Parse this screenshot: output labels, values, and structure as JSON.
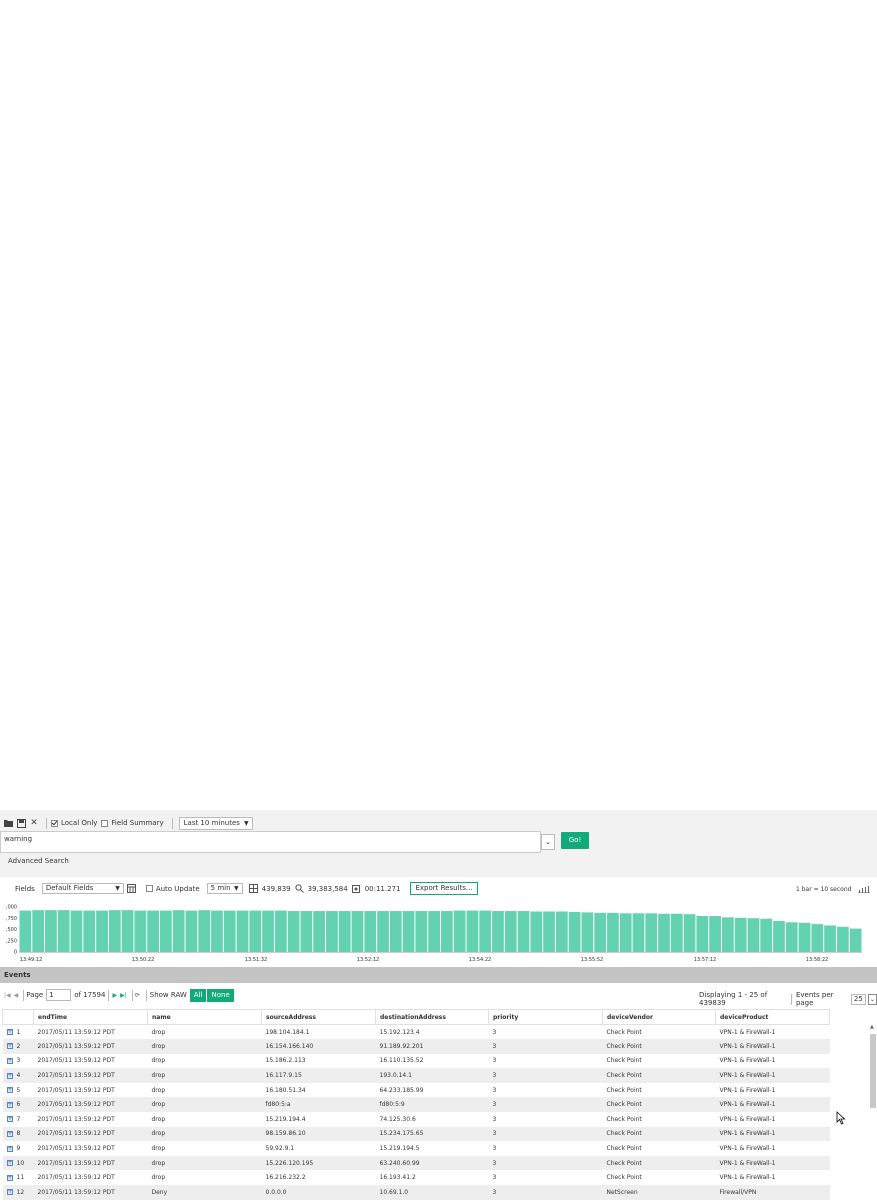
{
  "toolbar": {
    "local_only_label": "Local Only",
    "local_only_checked": true,
    "field_summary_label": "Field Summary",
    "field_summary_checked": false,
    "time_range": "Last 10 minutes"
  },
  "search": {
    "query": "warning",
    "go_label": "Go!",
    "advanced_label": "Advanced Search"
  },
  "fields_bar": {
    "fields_label": "Fields",
    "fields_value": "Default Fields",
    "auto_update_label": "Auto Update",
    "auto_update_checked": false,
    "interval": "5 min",
    "event_count": "439,839",
    "scanned_count": "39,383,584",
    "elapsed": "00:11.271",
    "export_label": "Export Results...",
    "bar_scale": "1 bar = 10 second"
  },
  "chart_data": {
    "type": "bar",
    "y_ticks": [
      "0",
      ",250",
      ",500",
      ",750",
      ",000"
    ],
    "x_ticks": [
      "13:49:12",
      "13:50:22",
      "13:51:32",
      "13:52:12",
      "13:54:22",
      "13:55:52",
      "13:57:12",
      "13:58:22"
    ],
    "values": [
      0.92,
      0.93,
      0.93,
      0.93,
      0.92,
      0.92,
      0.92,
      0.93,
      0.93,
      0.92,
      0.92,
      0.92,
      0.93,
      0.92,
      0.93,
      0.92,
      0.92,
      0.92,
      0.92,
      0.92,
      0.92,
      0.91,
      0.91,
      0.91,
      0.91,
      0.91,
      0.91,
      0.91,
      0.91,
      0.91,
      0.91,
      0.91,
      0.91,
      0.91,
      0.92,
      0.92,
      0.92,
      0.91,
      0.91,
      0.91,
      0.9,
      0.9,
      0.9,
      0.89,
      0.88,
      0.87,
      0.87,
      0.86,
      0.86,
      0.86,
      0.85,
      0.85,
      0.84,
      0.8,
      0.8,
      0.77,
      0.76,
      0.75,
      0.74,
      0.69,
      0.66,
      0.65,
      0.62,
      0.59,
      0.56,
      0.52
    ],
    "color": "#64d2b1"
  },
  "events": {
    "title": "Events",
    "page_label": "Page",
    "page_value": "1",
    "of_pages": "of 17594",
    "show_raw_label": "Show RAW",
    "all_label": "All",
    "none_label": "None",
    "displaying": "Displaying 1 - 25 of 439839",
    "epp_label": "Events per page",
    "epp_value": "25",
    "columns": [
      "endTime",
      "name",
      "sourceAddress",
      "destinationAddress",
      "priority",
      "deviceVendor",
      "deviceProduct"
    ],
    "rows": [
      [
        "1",
        "2017/05/11 13:59:12 PDT",
        "drop",
        "198.104.184.1",
        "15.192.123.4",
        "3",
        "Check Point",
        "VPN-1 & FireWall-1"
      ],
      [
        "2",
        "2017/05/11 13:59:12 PDT",
        "drop",
        "16.154.166.140",
        "91.189.92.201",
        "3",
        "Check Point",
        "VPN-1 & FireWall-1"
      ],
      [
        "3",
        "2017/05/11 13:59:12 PDT",
        "drop",
        "15.186.2.113",
        "16.110.135.52",
        "3",
        "Check Point",
        "VPN-1 & FireWall-1"
      ],
      [
        "4",
        "2017/05/11 13:59:12 PDT",
        "drop",
        "16.117.9.15",
        "193.0.14.1",
        "3",
        "Check Point",
        "VPN-1 & FireWall-1"
      ],
      [
        "5",
        "2017/05/11 13:59:12 PDT",
        "drop",
        "16.180.51.34",
        "64.233.185.99",
        "3",
        "Check Point",
        "VPN-1 & FireWall-1"
      ],
      [
        "6",
        "2017/05/11 13:59:12 PDT",
        "drop",
        "fd80:5:a",
        "fd80:5:9",
        "3",
        "Check Point",
        "VPN-1 & FireWall-1"
      ],
      [
        "7",
        "2017/05/11 13:59:12 PDT",
        "drop",
        "15.219.194.4",
        "74.125.30.6",
        "3",
        "Check Point",
        "VPN-1 & FireWall-1"
      ],
      [
        "8",
        "2017/05/11 13:59:12 PDT",
        "drop",
        "98.159.86.10",
        "15.234.175.65",
        "3",
        "Check Point",
        "VPN-1 & FireWall-1"
      ],
      [
        "9",
        "2017/05/11 13:59:12 PDT",
        "drop",
        "59.92.9.1",
        "15.219.194.5",
        "3",
        "Check Point",
        "VPN-1 & FireWall-1"
      ],
      [
        "10",
        "2017/05/11 13:59:12 PDT",
        "drop",
        "15.226.120.195",
        "63.240.60.99",
        "3",
        "Check Point",
        "VPN-1 & FireWall-1"
      ],
      [
        "11",
        "2017/05/11 13:59:12 PDT",
        "drop",
        "16.216.232.2",
        "16.193.41.2",
        "3",
        "Check Point",
        "VPN-1 & FireWall-1"
      ],
      [
        "12",
        "2017/05/11 13:59:12 PDT",
        "Deny",
        "0.0.0.0",
        "10.69.1.0",
        "3",
        "NetScreen",
        "Firewall/VPN"
      ]
    ]
  }
}
